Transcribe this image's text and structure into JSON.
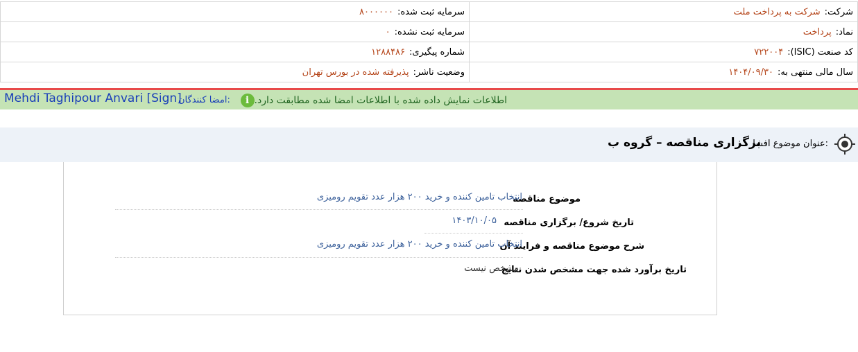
{
  "company_info": {
    "company_label": "شرکت:",
    "company_value": "شرکت به پرداخت ملت",
    "registered_capital_label": "سرمایه ثبت شده:",
    "registered_capital_value": "۸۰۰۰۰۰۰",
    "symbol_label": "نماد:",
    "symbol_value": "پرداخت",
    "unregistered_capital_label": "سرمایه ثبت نشده:",
    "unregistered_capital_value": "۰",
    "isic_label": "کد صنعت (ISIC):",
    "isic_value": "۷۲۲۰۰۴",
    "tracking_label": "شماره پیگیری:",
    "tracking_value": "۱۲۸۸۴۸۶",
    "fiscal_year_label": "سال مالی منتهی به:",
    "fiscal_year_value": "۱۴۰۴/۰۹/۳۰",
    "publisher_status_label": "وضعیت ناشر:",
    "publisher_status_value": "پذیرفته شده در بورس تهران"
  },
  "signature": {
    "signers_label": "امضا کنندگان:",
    "signer_name": "Mehdi Taghipour Anvari [Sign]",
    "verified_text": "اطلاعات نمایش داده شده با اطلاعات امضا شده مطابقت دارد."
  },
  "disclosure": {
    "title_label": "عنوان موضوع افشا:",
    "title_value": "برگزاری مناقصه – گروه ب"
  },
  "details": [
    {
      "label": "موضوع مناقصه",
      "value": "انتخاب تامین کننده و خرید ۲۰۰ هزار عدد تقویم رومیزی"
    },
    {
      "label": "تاریخ شروع/ برگزاری مناقصه",
      "value": "۱۴۰۳/۱۰/۰۵"
    },
    {
      "label": "شرح موضوع مناقصه و فرایند آن",
      "value": "انتخاب تامین کننده و خرید ۲۰۰ هزار عدد تقویم رومیزی"
    },
    {
      "label": "تاریخ برآورد شده جهت مشخص شدن نتایج",
      "value": "مشخص نیست"
    }
  ],
  "colors": {
    "value_text": "#b5461b",
    "detail_value_text": "#3a5f9a",
    "banner_green": "#c5e3b5",
    "divider_red": "#e84a4a"
  }
}
